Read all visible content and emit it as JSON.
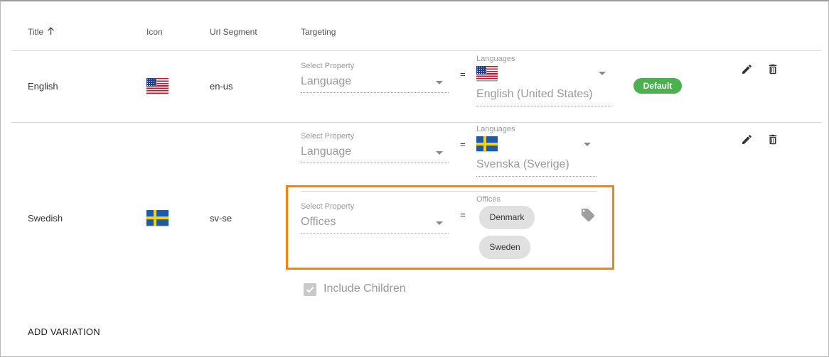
{
  "header": {
    "title_col": "Title",
    "icon_col": "Icon",
    "url_col": "Url Segment",
    "targeting_col": "Targeting"
  },
  "rows": [
    {
      "title": "English",
      "url": "en-us",
      "flag": "us-flag",
      "targeting": [
        {
          "property_label": "Select Property",
          "property_value": "Language",
          "operator": "=",
          "values_label": "Languages",
          "value_text": "English (United States)"
        }
      ],
      "badge": "Default"
    },
    {
      "title": "Swedish",
      "url": "sv-se",
      "flag": "se-flag",
      "targeting": [
        {
          "property_label": "Select Property",
          "property_value": "Language",
          "operator": "=",
          "values_label": "Languages",
          "value_text": "Svenska (Sverige)"
        },
        {
          "property_label": "Select Property",
          "property_value": "Offices",
          "operator": "=",
          "values_label": "Offices",
          "chips": [
            "Denmark",
            "Sweden"
          ]
        }
      ],
      "include_children": "Include Children"
    }
  ],
  "add_variation": "ADD VARIATION",
  "colors": {
    "highlight": "#f7820b",
    "badge": "#4caf50"
  },
  "icons": [
    "arrow-up-icon",
    "pencil-icon",
    "trash-icon",
    "tag-icon",
    "checkbox-icon",
    "us-flag",
    "se-flag"
  ]
}
